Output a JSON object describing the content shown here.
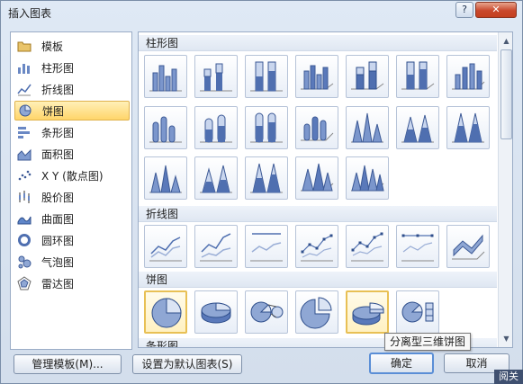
{
  "window": {
    "title": "插入图表",
    "help": "?",
    "close": "✕"
  },
  "left_nav": {
    "items": [
      {
        "label": "模板",
        "icon": "folder-icon"
      },
      {
        "label": "柱形图",
        "icon": "column-chart-icon"
      },
      {
        "label": "折线图",
        "icon": "line-chart-icon"
      },
      {
        "label": "饼图",
        "icon": "pie-chart-icon",
        "selected": true
      },
      {
        "label": "条形图",
        "icon": "bar-chart-icon"
      },
      {
        "label": "面积图",
        "icon": "area-chart-icon"
      },
      {
        "label": "X Y (散点图)",
        "icon": "scatter-chart-icon"
      },
      {
        "label": "股价图",
        "icon": "stock-chart-icon"
      },
      {
        "label": "曲面图",
        "icon": "surface-chart-icon"
      },
      {
        "label": "圆环图",
        "icon": "doughnut-chart-icon"
      },
      {
        "label": "气泡图",
        "icon": "bubble-chart-icon"
      },
      {
        "label": "雷达图",
        "icon": "radar-chart-icon"
      }
    ]
  },
  "sections": {
    "column": "柱形图",
    "line": "折线图",
    "pie": "饼图",
    "bar": "条形图"
  },
  "tooltip": "分离型三维饼图",
  "buttons": {
    "manage_templates": "管理模板(M)...",
    "set_default": "设置为默认图表(S)",
    "ok": "确定",
    "cancel": "取消"
  },
  "corner_label": "阅关",
  "colors": {
    "accent": "#5b7fbf",
    "selection": "#ffd56a"
  }
}
